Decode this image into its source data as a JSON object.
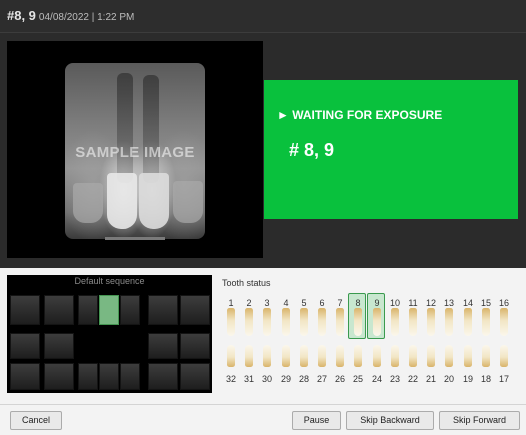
{
  "header": {
    "title": "#8, 9",
    "datetime": "04/08/2022 | 1:22 PM"
  },
  "image_panel": {
    "watermark": "SAMPLE IMAGE"
  },
  "status_panel": {
    "message": "► WAITING FOR EXPOSURE",
    "teeth": "# 8, 9",
    "color": "#09c13d"
  },
  "sequence": {
    "title": "Default sequence"
  },
  "tooth_status": {
    "title": "Tooth status",
    "upper": [
      "1",
      "2",
      "3",
      "4",
      "5",
      "6",
      "7",
      "8",
      "9",
      "10",
      "11",
      "12",
      "13",
      "14",
      "15",
      "16"
    ],
    "lower": [
      "32",
      "31",
      "30",
      "29",
      "28",
      "27",
      "26",
      "25",
      "24",
      "23",
      "22",
      "21",
      "20",
      "19",
      "18",
      "17"
    ],
    "selected": [
      "8",
      "9"
    ]
  },
  "footer": {
    "cancel": "Cancel",
    "pause": "Pause",
    "skip_backward": "Skip Backward",
    "skip_forward": "Skip Forward"
  }
}
